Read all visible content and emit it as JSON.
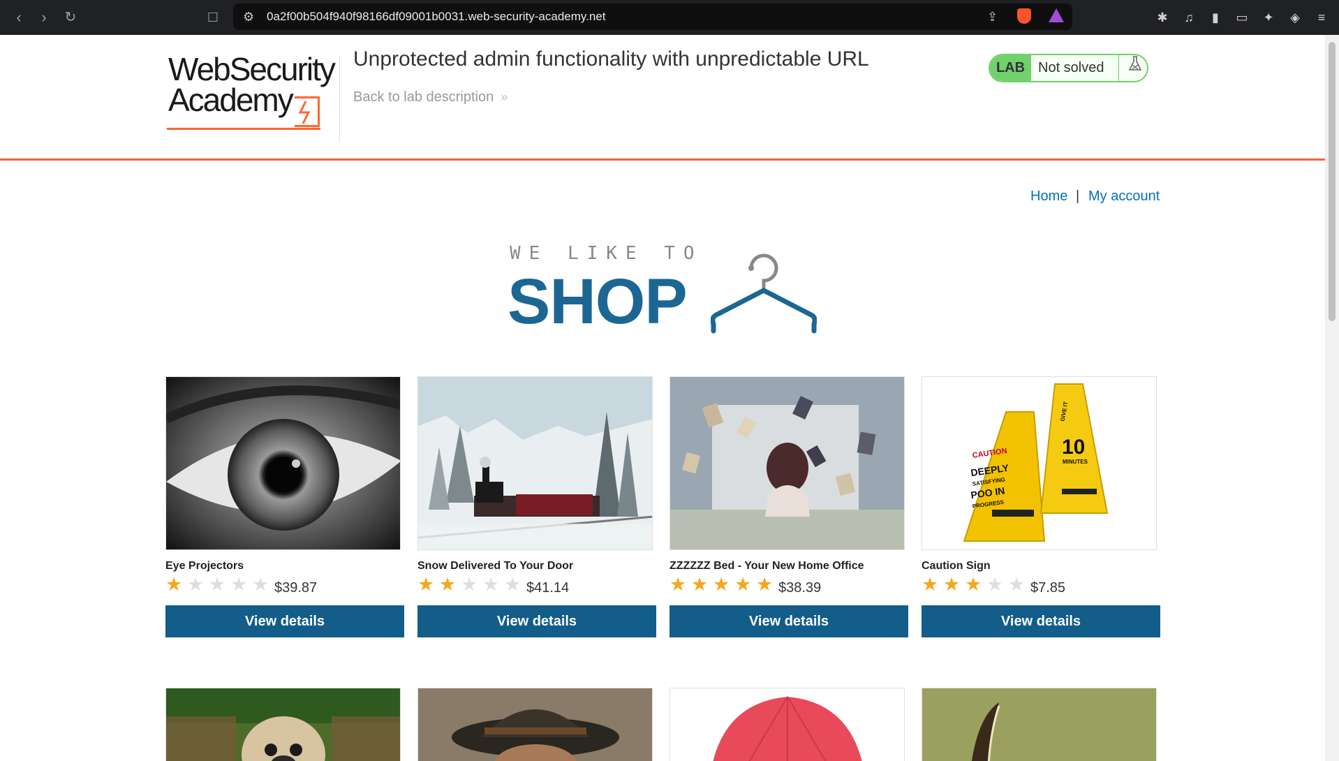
{
  "browser": {
    "url": "0a2f00b504f940f98166df09001b0031.web-security-academy.net"
  },
  "header": {
    "logo_line1": "WebSecurity",
    "logo_line2": "Academy",
    "lab_title": "Unprotected admin functionality with unpredictable URL",
    "back_link": "Back to lab description",
    "status_badge": "LAB",
    "status_text": "Not solved"
  },
  "nav": {
    "home": "Home",
    "separator": "|",
    "account": "My account"
  },
  "hero": {
    "small": "WE LIKE TO",
    "big": "SHOP"
  },
  "colors": {
    "accent": "#ff6633",
    "brand_blue": "#125d89",
    "star": "#f5a81c",
    "lab_green": "#70d16d"
  },
  "products": [
    {
      "name": "Eye Projectors",
      "price": "$39.87",
      "rating": 1,
      "button": "View details"
    },
    {
      "name": "Snow Delivered To Your Door",
      "price": "$41.14",
      "rating": 2,
      "button": "View details"
    },
    {
      "name": "ZZZZZZ Bed - Your New Home Office",
      "price": "$38.39",
      "rating": 5,
      "button": "View details"
    },
    {
      "name": "Caution Sign",
      "price": "$7.85",
      "rating": 3,
      "button": "View details"
    }
  ],
  "sign_text": {
    "caution": "CAUTION",
    "deeply": "DEEPLY",
    "satisfying": "SATISFYING",
    "poo": "POO IN",
    "progress": "PROGRESS",
    "give": "GIVE IT",
    "ten": "10",
    "minutes": "MINUTES"
  }
}
